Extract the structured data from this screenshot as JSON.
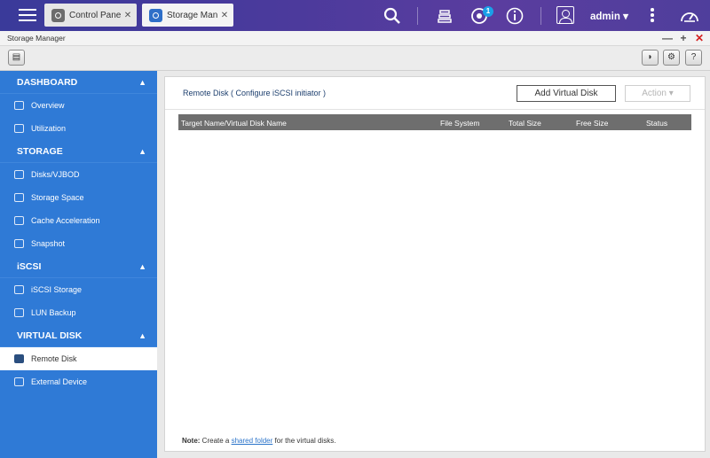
{
  "topbar": {
    "tabs": [
      {
        "label": "Control Panel",
        "icon": "gear-icon"
      },
      {
        "label": "Storage Man...",
        "icon": "storage-icon"
      }
    ],
    "notification_count": "1",
    "username": "admin",
    "accent": "#4a3d9c"
  },
  "window": {
    "title": "Storage Manager",
    "controls": [
      "minimize",
      "maximize",
      "close"
    ]
  },
  "sidebar": {
    "sections": [
      {
        "label": "DASHBOARD",
        "items": [
          {
            "label": "Overview",
            "icon": "overview-icon"
          },
          {
            "label": "Utilization",
            "icon": "chart-icon"
          }
        ]
      },
      {
        "label": "STORAGE",
        "items": [
          {
            "label": "Disks/VJBOD",
            "icon": "disk-icon"
          },
          {
            "label": "Storage Space",
            "icon": "storage-space-icon"
          },
          {
            "label": "Cache Acceleration",
            "icon": "cache-icon"
          },
          {
            "label": "Snapshot",
            "icon": "snapshot-icon"
          }
        ]
      },
      {
        "label": "iSCSI",
        "items": [
          {
            "label": "iSCSI Storage",
            "icon": "iscsi-icon"
          },
          {
            "label": "LUN Backup",
            "icon": "backup-icon"
          }
        ]
      },
      {
        "label": "VIRTUAL DISK",
        "items": [
          {
            "label": "Remote Disk",
            "icon": "remote-disk-icon",
            "active": true
          },
          {
            "label": "External Device",
            "icon": "external-device-icon"
          }
        ]
      }
    ]
  },
  "main": {
    "breadcrumb": "Remote Disk ( Configure iSCSI initiator )",
    "add_button": "Add Virtual Disk",
    "action_button": "Action",
    "columns": [
      "Target Name/Virtual Disk Name",
      "File System",
      "Total Size",
      "Free Size",
      "Status"
    ],
    "note_label": "Note:",
    "note_pre": " Create a ",
    "note_link": "shared folder",
    "note_post": " for the virtual disks."
  }
}
